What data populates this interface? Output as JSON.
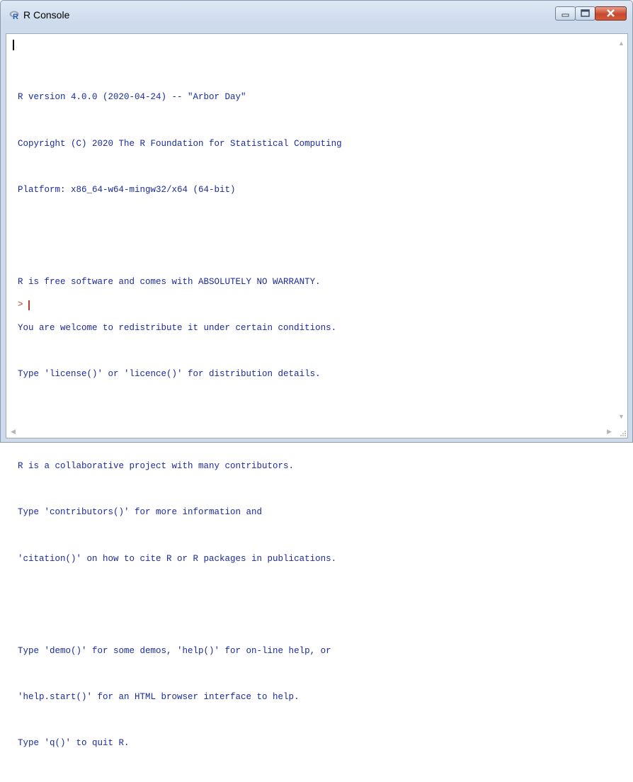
{
  "window": {
    "title": "R Console",
    "accent_color": "#1a2a9a",
    "prompt_color": "#c0392b",
    "controls": [
      "minimize-icon",
      "maximize-icon",
      "close-icon"
    ]
  },
  "console": {
    "lines": [
      "R version 4.0.0 (2020-04-24) -- \"Arbor Day\"",
      "Copyright (C) 2020 The R Foundation for Statistical Computing",
      "Platform: x86_64-w64-mingw32/x64 (64-bit)",
      "",
      "R is free software and comes with ABSOLUTELY NO WARRANTY.",
      "You are welcome to redistribute it under certain conditions.",
      "Type 'license()' or 'licence()' for distribution details.",
      "",
      "R is a collaborative project with many contributors.",
      "Type 'contributors()' for more information and",
      "'citation()' on how to cite R or R packages in publications.",
      "",
      "Type 'demo()' for some demos, 'help()' for on-line help, or",
      "'help.start()' for an HTML browser interface to help.",
      "Type 'q()' to quit R."
    ],
    "prompt": ">"
  }
}
